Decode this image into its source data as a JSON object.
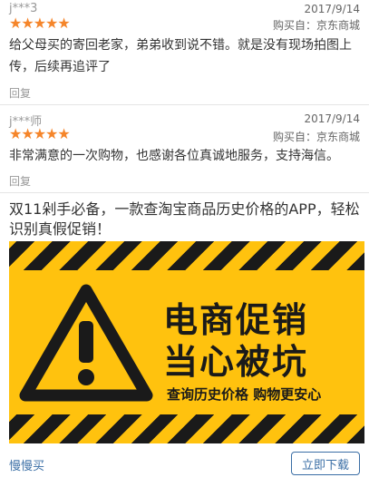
{
  "reviews": [
    {
      "user": "j***3",
      "date": "2017/9/14",
      "stars": "★★★★★",
      "source": "购买自：京东商城",
      "content": "给父母买的寄回老家，弟弟收到说不错。就是没有现场拍图上传，后续再追评了",
      "reply": "回复"
    },
    {
      "user": "j***师",
      "date": "2017/9/14",
      "stars": "★★★★★",
      "source": "购买自：京东商城",
      "content": "非常满意的一次购物，也感谢各位真诚地服务，支持海信。",
      "reply": "回复"
    }
  ],
  "ad": {
    "text": "双11剁手必备，一款查淘宝商品历史价格的APP，轻松识别真假促销！",
    "banner": {
      "line1": "电商促销",
      "line2": "当心被坑",
      "line3": "查询历史价格 购物更安心"
    },
    "source_link": "慢慢买",
    "download_label": "立即下载"
  },
  "colors": {
    "star": "#f5852a",
    "banner_yellow": "#ffc20e",
    "link_blue": "#3a6ea5"
  }
}
